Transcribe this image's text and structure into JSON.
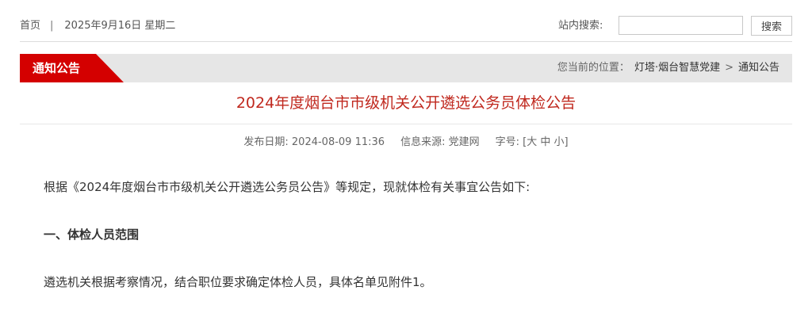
{
  "topbar": {
    "home_label": "首页",
    "separator": "|",
    "date": "2025年9月16日 星期二",
    "search_label": "站内搜索:",
    "search_value": "",
    "search_button": "搜索"
  },
  "section": {
    "title": "通知公告",
    "crumb_prefix": "您当前的位置：",
    "crumbs": [
      "灯塔·烟台智慧党建",
      "通知公告"
    ],
    "crumb_separator": ">"
  },
  "article": {
    "title": "2024年度烟台市市级机关公开遴选公务员体检公告",
    "meta": {
      "publish_date_label": "发布日期:",
      "publish_date": "2024-08-09 11:36",
      "source_label": "信息来源:",
      "source": "党建网",
      "font_size_label": "字号:",
      "font_size_open": "[",
      "font_sizes": [
        "大",
        "中",
        "小"
      ],
      "font_size_close": "]"
    },
    "paragraphs": [
      "根据《2024年度烟台市市级机关公开遴选公务员公告》等规定，现就体检有关事宜公告如下:",
      "一、体检人员范围",
      "遴选机关根据考察情况，结合职位要求确定体检人员，具体名单见附件1。"
    ]
  },
  "colors": {
    "accent_red": "#d40000",
    "title_red": "#c0281e",
    "section_bar_gray": "#e6e6e6"
  }
}
